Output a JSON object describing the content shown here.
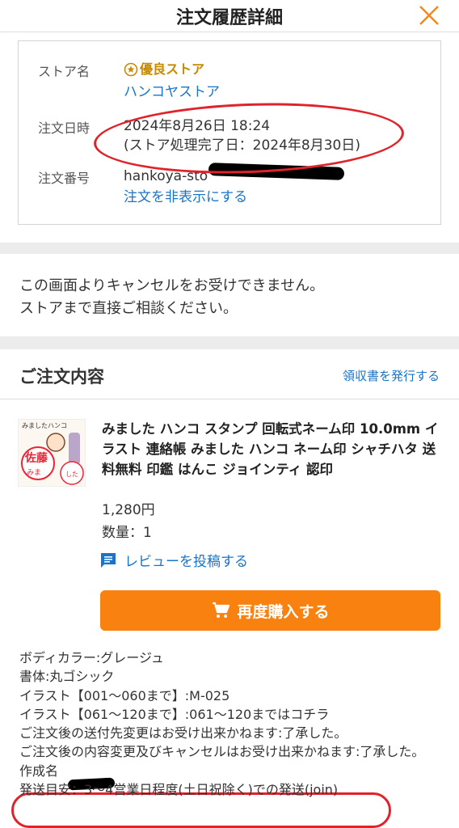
{
  "header": {
    "title": "注文履歴詳細"
  },
  "order_info": {
    "store_label": "ストア名",
    "store_badge": "優良ストア",
    "store_name": "ハンコヤストア",
    "date_label": "注文日時",
    "date_value": "2024年8月26日 18:24",
    "completion_value": "(ストア処理完了日：2024年8月30日)",
    "number_label": "注文番号",
    "number_value": "hankoya-sto",
    "hide_link": "注文を非表示にする"
  },
  "notice": {
    "line1": "この画面よりキャンセルをお受けできません。",
    "line2": "ストアまで直接ご相談ください。"
  },
  "order_section": {
    "title": "ご注文内容",
    "receipt_link": "領収書を発行する"
  },
  "product": {
    "name": "みました ハンコ スタンプ 回転式ネーム印 10.0mm イラスト 連絡帳 みました ハンコ ネーム印 シャチハタ 送料無料 印鑑 はんこ ジョインティ 認印",
    "price": "1,280円",
    "quantity_label": "数量",
    "quantity_sep": "：",
    "quantity": "1",
    "review_link": "レビューを投稿する",
    "rebuy_button": "再度購入する",
    "thumb_title": "みましたハンコ",
    "thumb_name": "佐藤",
    "thumb_text": "みま",
    "thumb_text2": "した"
  },
  "options": [
    "ボディカラー:グレージュ",
    "書体:丸ゴシック",
    "イラスト【001～060まで】:M-025",
    "イラスト【061～120まで】:061～120まではコチラ",
    "ご注文後の送付先変更はお受け出来かねます:了承した。",
    "ご注文後の内容変更及びキャンセルはお受け出来かねます:了承した。",
    "作成名",
    "発送目安：3～4営業日程度(土日祝除く)での発送(join)"
  ],
  "colors": {
    "accent": "#f8810f",
    "link": "#1a74c9",
    "annotation": "#e0222b",
    "badge": "#c78a00"
  }
}
